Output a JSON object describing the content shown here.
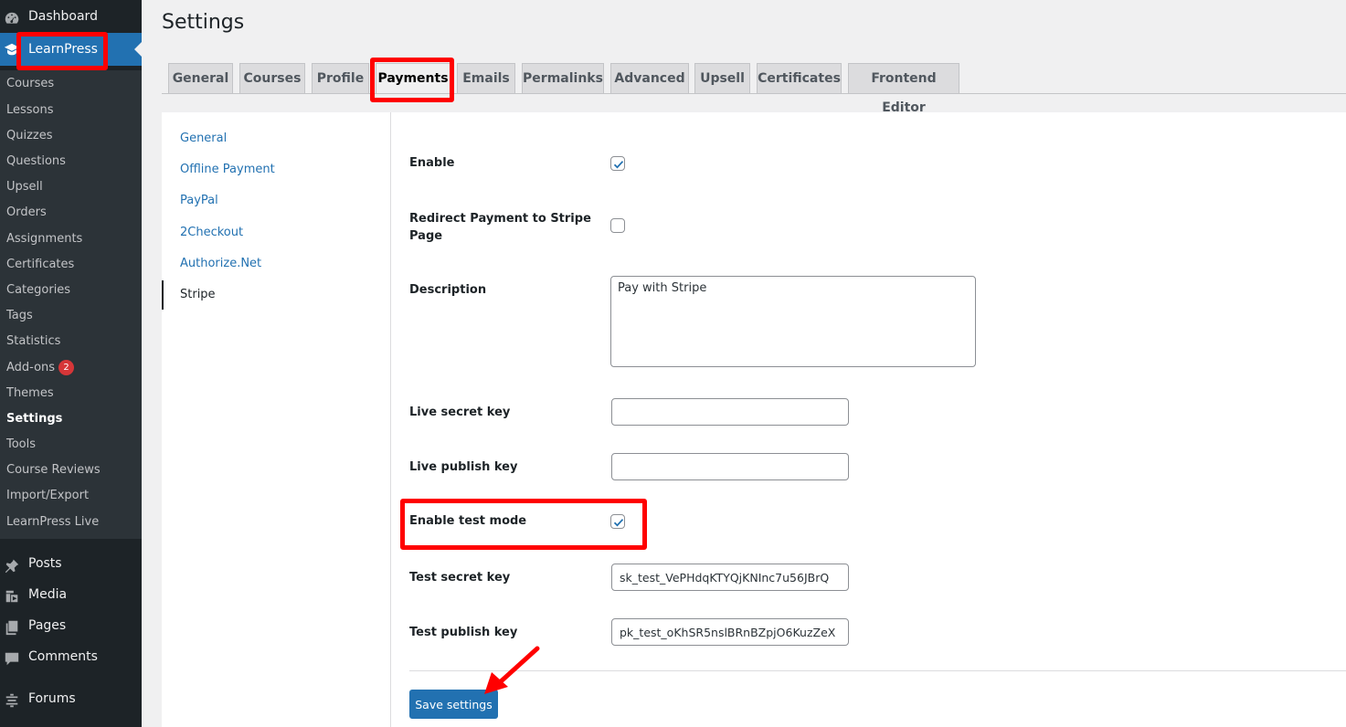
{
  "sidebar": {
    "dashboard": {
      "label": "Dashboard",
      "icon": "dashboard-icon"
    },
    "learnpress": {
      "label": "LearnPress",
      "icon": "graduation-cap-icon"
    },
    "submenu": [
      "Courses",
      "Lessons",
      "Quizzes",
      "Questions",
      "Upsell",
      "Orders",
      "Assignments",
      "Certificates",
      "Categories",
      "Tags",
      "Statistics",
      "Add-ons",
      "Themes",
      "Settings",
      "Tools",
      "Course Reviews",
      "Import/Export",
      "LearnPress Live"
    ],
    "addons_badge": "2",
    "active_submenu": "Settings",
    "posts": {
      "label": "Posts",
      "icon": "pushpin-icon"
    },
    "media": {
      "label": "Media",
      "icon": "media-icon"
    },
    "pages": {
      "label": "Pages",
      "icon": "pages-icon"
    },
    "comments": {
      "label": "Comments",
      "icon": "comment-icon"
    },
    "forums": {
      "label": "Forums",
      "icon": "forums-icon"
    }
  },
  "page": {
    "title": "Settings"
  },
  "tabs": [
    "General",
    "Courses",
    "Profile",
    "Payments",
    "Emails",
    "Permalinks",
    "Advanced",
    "Upsell",
    "Certificates",
    "Frontend Editor"
  ],
  "active_tab": "Payments",
  "payment_nav": [
    "General",
    "Offline Payment",
    "PayPal",
    "2Checkout",
    "Authorize.Net",
    "Stripe"
  ],
  "active_payment": "Stripe",
  "form": {
    "enable": {
      "label": "Enable",
      "checked": true
    },
    "redirect": {
      "label_line1": "Redirect Payment to Stripe",
      "label_line2": "Page",
      "checked": false
    },
    "description": {
      "label": "Description",
      "value": "Pay with Stripe"
    },
    "live_secret_key": {
      "label": "Live secret key",
      "value": ""
    },
    "live_publish_key": {
      "label": "Live publish key",
      "value": ""
    },
    "test_mode": {
      "label": "Enable test mode",
      "checked": true
    },
    "test_secret_key": {
      "label": "Test secret key",
      "value": "sk_test_VePHdqKTYQjKNInc7u56JBrQ"
    },
    "test_publish_key": {
      "label": "Test publish key",
      "value": "pk_test_oKhSR5nslBRnBZpjO6KuzZeX"
    }
  },
  "save_button": "Save settings",
  "colors": {
    "wp_blue": "#2271b1",
    "sidebar_bg": "#1d2327",
    "annotation_red": "#ff0000"
  }
}
